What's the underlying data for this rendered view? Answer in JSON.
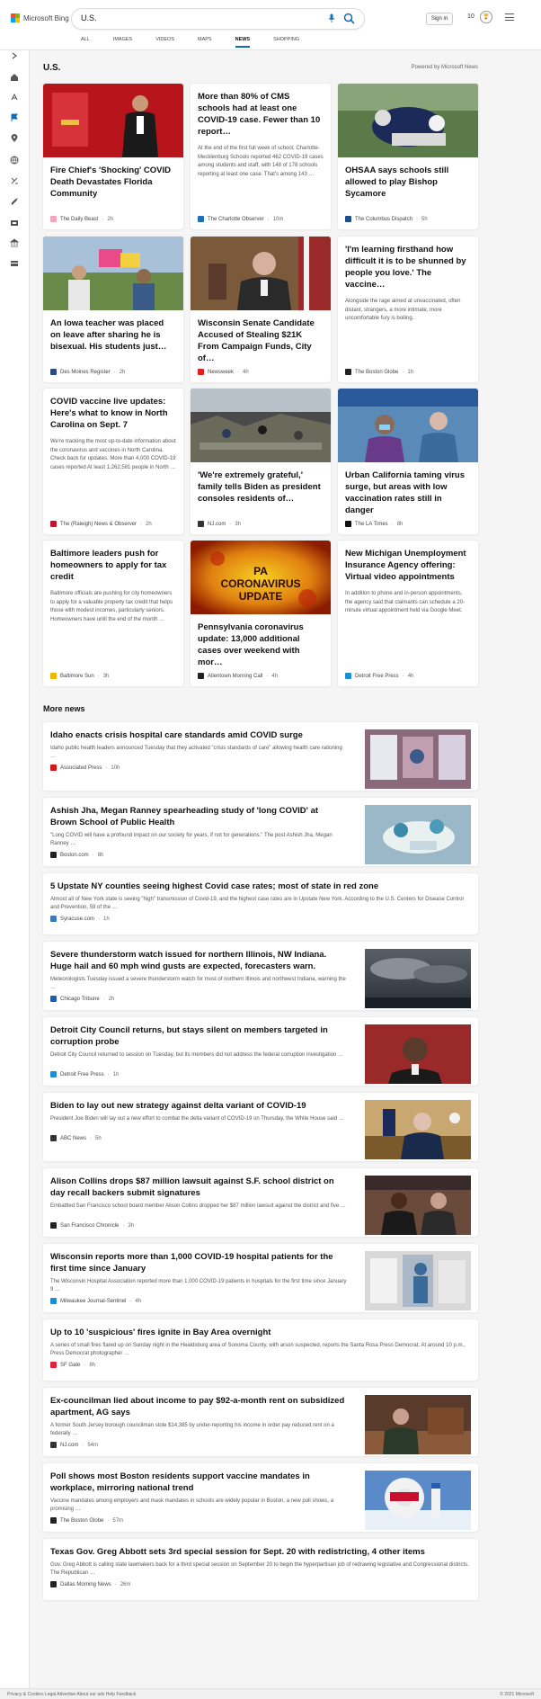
{
  "header": {
    "logo_text": "Microsoft Bing",
    "search_value": "U.S.",
    "signin_label": "Sign in",
    "rewards_count": "10",
    "tabs": [
      {
        "label": "ALL"
      },
      {
        "label": "IMAGES"
      },
      {
        "label": "VIDEOS"
      },
      {
        "label": "MAPS"
      },
      {
        "label": "NEWS"
      },
      {
        "label": "SHOPPING"
      }
    ],
    "active_tab": "NEWS"
  },
  "page": {
    "title": "U.S.",
    "powered_by": "Powered by Microsoft News"
  },
  "cards": [
    {
      "title": "Fire Chief's 'Shocking' COVID Death Devastates Florida Community",
      "snippet": "",
      "source": "The Daily Beast",
      "age": "2h",
      "fav_color": "#f4a6b8"
    },
    {
      "title": "More than 80% of CMS schools had at least one COVID-19 case. Fewer than 10 report…",
      "snippet": "At the end of the first full week of school, Charlotte-Mecklenburg Schools reported 462 COVID-19 cases among students and staff, with 148 of 178 schools reporting at least one case. That's among 143 …",
      "source": "The Charlotte Observer",
      "age": "10m",
      "fav_color": "#1d6fb8"
    },
    {
      "title": "OHSAA says schools still allowed to play Bishop Sycamore",
      "snippet": "",
      "source": "The Columbus Dispatch",
      "age": "5h",
      "fav_color": "#1c4f8c"
    },
    {
      "title": "An Iowa teacher was placed on leave after sharing he is bisexual. His students just…",
      "snippet": "",
      "source": "Des Moines Register",
      "age": "2h",
      "fav_color": "#2b4a8c"
    },
    {
      "title": "Wisconsin Senate Candidate Accused of Stealing $21K From Campaign Funds, City of…",
      "snippet": "",
      "source": "Newsweek",
      "age": "4h",
      "fav_color": "#e0201b"
    },
    {
      "title": "'I'm learning firsthand how difficult it is to be shunned by people you love.' The vaccine…",
      "snippet": "Alongside the rage aimed at unvaccinated, often distant, strangers, a more intimate, more uncomfortable fury is boiling.",
      "source": "The Boston Globe",
      "age": "1h",
      "fav_color": "#222222"
    },
    {
      "title": "COVID vaccine live updates: Here's what to know in North Carolina on Sept. 7",
      "snippet": "We're tracking the most up-to-date information about the coronavirus and vaccines in North Carolina. Check back for updates. More than 4,000 COVID-19 cases reported At least 1,262,581 people in North …",
      "source": "The (Raleigh) News & Observer",
      "age": "2h",
      "fav_color": "#c8102e"
    },
    {
      "title": "'We're extremely grateful,' family tells Biden as president consoles residents of…",
      "snippet": "",
      "source": "NJ.com",
      "age": "3h",
      "fav_color": "#333333"
    },
    {
      "title": "Urban California taming virus surge, but areas with low vaccination rates still in danger",
      "snippet": "",
      "source": "The LA Times",
      "age": "8h",
      "fav_color": "#111111"
    },
    {
      "title": "Baltimore leaders push for homeowners to apply for tax credit",
      "snippet": "Baltimore officials are pushing for city homeowners to apply for a valuable property tax credit that helps those with modest incomes, particularly seniors. Homeowners have until the end of the month …",
      "source": "Baltimore Sun",
      "age": "3h",
      "fav_color": "#f2b600"
    },
    {
      "title": "Pennsylvania coronavirus update: 13,000 additional cases over weekend with mor…",
      "snippet": "",
      "source": "Allentown Morning Call",
      "age": "4h",
      "fav_color": "#222222"
    },
    {
      "title": "New Michigan Unemployment Insurance Agency offering: Virtual video appointments",
      "snippet": "In addition to phone and in-person appointments, the agency said that claimants can schedule a 20-minute virtual appointment held via Google Meet.",
      "source": "Detroit Free Press",
      "age": "4h",
      "fav_color": "#1a8fd6"
    }
  ],
  "more_news": {
    "heading": "More news",
    "items": [
      {
        "title": "Idaho enacts crisis hospital care standards amid COVID surge",
        "snippet": "Idaho public health leaders announced Tuesday that they activated \"crisis standards of care\" allowing health care rationing …",
        "source": "Associated Press",
        "age": "10h",
        "fav_color": "#d7141a"
      },
      {
        "title": "Ashish Jha, Megan Ranney spearheading study of 'long COVID' at Brown School of Public Health",
        "snippet": "\"Long COVID will have a profound impact on our society for years, if not for generations.\" The post Ashish Jha, Megan Ranney …",
        "source": "Boston.com",
        "age": "8h",
        "fav_color": "#222222"
      },
      {
        "title": "5 Upstate NY counties seeing highest Covid case rates; most of state in red zone",
        "snippet": "Almost all of New York state is seeing \"high\" transmission of Covid-19, and the highest case rates are in Upstate New York. According to the U.S. Centers for Disease Control and Prevention, 59 of the …",
        "source": "Syracuse.com",
        "age": "1h",
        "fav_color": "#3a78c2"
      },
      {
        "title": "Severe thunderstorm watch issued for northern Illinois, NW Indiana. Huge hail and 60 mph wind gusts are expected, forecasters warn.",
        "snippet": "Meteorologists Tuesday issued a severe thunderstorm watch for most of northern Illinois and northwest Indiana, warning the …",
        "source": "Chicago Tribune",
        "age": "2h",
        "fav_color": "#1f5fa6"
      },
      {
        "title": "Detroit City Council returns, but stays silent on members targeted in corruption probe",
        "snippet": "Detroit City Council returned to session on Tuesday, but its members did not address the federal corruption investigation …",
        "source": "Detroit Free Press",
        "age": "1h",
        "fav_color": "#1a8fd6"
      },
      {
        "title": "Biden to lay out new strategy against delta variant of COVID-19",
        "snippet": "President Joe Biden will lay out a new effort to combat the delta variant of COVID-19 on Thursday, the White House said …",
        "source": "ABC News",
        "age": "5h",
        "fav_color": "#333333"
      },
      {
        "title": "Alison Collins drops $87 million lawsuit against S.F. school district on day recall backers submit signatures",
        "snippet": "Embattled San Francisco school board member Alison Collins dropped her $87 million lawsuit against the district and five …",
        "source": "San Francisco Chronicle",
        "age": "3h",
        "fav_color": "#222222"
      },
      {
        "title": "Wisconsin reports more than 1,000 COVID-19 hospital patients for the first time since January",
        "snippet": "The Wisconsin Hospital Association reported more than 1,000 COVID-19 patients in hospitals for the first time since January 9 …",
        "source": "Milwaukee Journal-Sentinel",
        "age": "4h",
        "fav_color": "#1a8fd6"
      },
      {
        "title": "Up to 10 'suspicious' fires ignite in Bay Area overnight",
        "snippet": "A series of small fires flared up on Sunday night in the Healdsburg area of Sonoma County, with arson suspected, reports the Santa Rosa Press Democrat. At around 10 p.m., Press Democrat photographer …",
        "source": "SF Gate",
        "age": "8h",
        "fav_color": "#e5213a"
      },
      {
        "title": "Ex-councilman lied about income to pay $92-a-month rent on subsidized apartment, AG says",
        "snippet": "A former South Jersey borough councilman stole $14,385 by under-reporting his income in order pay reduced rent on a federally …",
        "source": "NJ.com",
        "age": "54m",
        "fav_color": "#333333"
      },
      {
        "title": "Poll shows most Boston residents support vaccine mandates in workplace, mirroring national trend",
        "snippet": "Vaccine mandates among employers and mask mandates in schools are widely popular in Boston, a new poll shows, a promising …",
        "source": "The Boston Globe",
        "age": "57m",
        "fav_color": "#222222"
      },
      {
        "title": "Texas Gov. Greg Abbott sets 3rd special session for Sept. 20 with redistricting, 4 other items",
        "snippet": "Gov. Greg Abbott is calling state lawmakers back for a third special session on September 20 to begin the hyperpartisan job of redrawing legislative and Congressional districts. The Republican …",
        "source": "Dallas Morning News",
        "age": "26m",
        "fav_color": "#222222"
      }
    ]
  },
  "sidebar": {
    "icons": [
      "chevron-right-icon",
      "home-icon",
      "discover-icon",
      "flag-icon",
      "location-icon",
      "globe-icon",
      "scale-icon",
      "rocket-icon",
      "film-icon",
      "bank-icon",
      "card-icon"
    ]
  },
  "footer": {
    "left": "Privacy & Cookies   Legal   Advertise   About our ads   Help   Feedback",
    "right": "© 2021 Microsoft"
  }
}
